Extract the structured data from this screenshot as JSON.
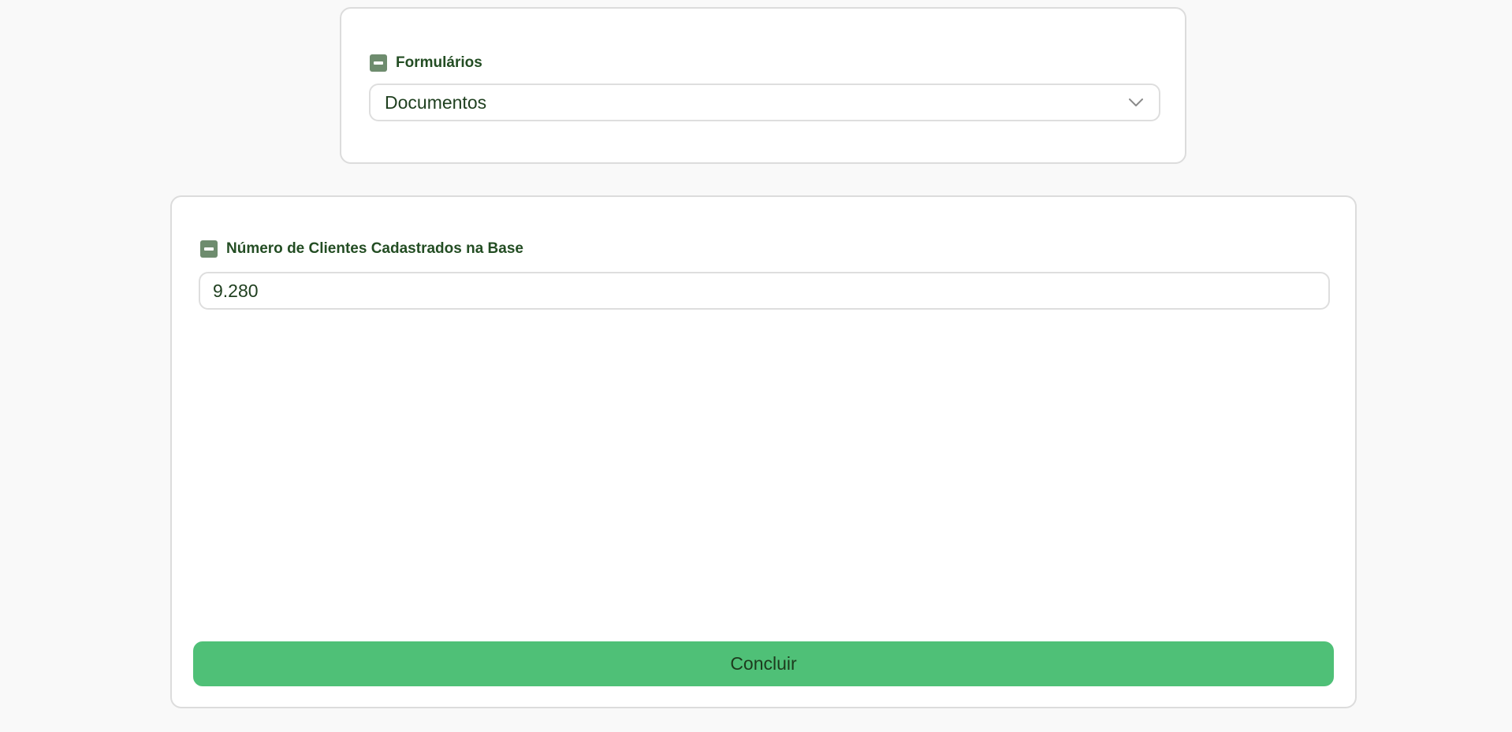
{
  "forms_section": {
    "label": "Formulários",
    "selected_value": "Documentos"
  },
  "clients_section": {
    "label": "Número de Clientes Cadastrados na Base",
    "input_value": "9.280"
  },
  "submit": {
    "label": "Concluir"
  },
  "colors": {
    "accent": "#4fc077",
    "label_text": "#234d23",
    "icon_bg": "#6e8c6e"
  },
  "icons": {
    "collapse": "minus-square-icon",
    "dropdown": "chevron-down-icon"
  }
}
